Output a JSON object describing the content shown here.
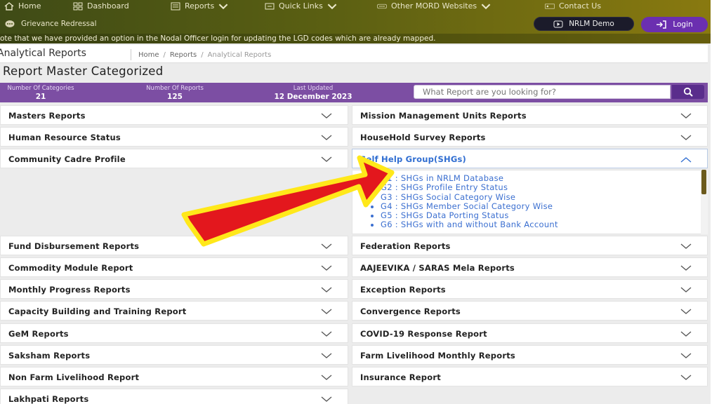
{
  "nav": {
    "home": "Home",
    "dashboard": "Dashboard",
    "reports": "Reports",
    "quick_links": "Quick Links",
    "other_mord": "Other MORD Websites",
    "contact": "Contact Us",
    "grievance": "Grievance Redressal",
    "nrlm_demo": "NRLM Demo",
    "login": "Login"
  },
  "ticker": "ote that we have provided an option in the Nodal Officer login for updating the LGD codes which are already mapped.",
  "page": {
    "title": "Analytical Reports",
    "breadcrumb": [
      "Home",
      "Reports",
      "Analytical Reports"
    ],
    "section_title": "Report Master Categorized"
  },
  "stats": {
    "categories_label": "Number Of Categories",
    "categories_value": "21",
    "reports_label": "Number Of Reports",
    "reports_value": "125",
    "updated_label": "Last Updated",
    "updated_value": "12 December 2023"
  },
  "search": {
    "placeholder": "What Report are you looking for?"
  },
  "left_categories": [
    "Masters Reports",
    "Human Resource Status",
    "Community Cadre Profile",
    "Fund Disbursement Reports",
    "Commodity Module Report",
    "Monthly Progress Reports",
    "Capacity Building and Training Report",
    "GeM Reports",
    "Saksham Reports",
    "Non Farm Livelihood Report",
    "Lakhpati Reports"
  ],
  "right_categories": [
    "Mission Management Units Reports",
    "HouseHold Survey Reports",
    "Self Help Group(SHGs)",
    "Federation Reports",
    "AAJEEVIKA / SARAS Mela Reports",
    "Exception Reports",
    "Convergence Reports",
    "COVID-19 Response Report",
    "Farm Livelihood Monthly Reports",
    "Insurance Report"
  ],
  "shg_reports": [
    "G1 :  SHGs in NRLM Database",
    "G2 : SHGs Profile Entry Status",
    "G3 :  SHGs Social Category Wise",
    "G4 : SHGs Member Social Category Wise",
    "G5 :  SHGs Data Porting Status",
    "G6 : SHGs with and without Bank Account"
  ],
  "colors": {
    "nav_bg": "#4a5414",
    "stats_bg": "#7c4ea3",
    "link": "#3b6fd0",
    "arrow_fill": "#e3171d",
    "arrow_outline": "#ffe81a"
  }
}
